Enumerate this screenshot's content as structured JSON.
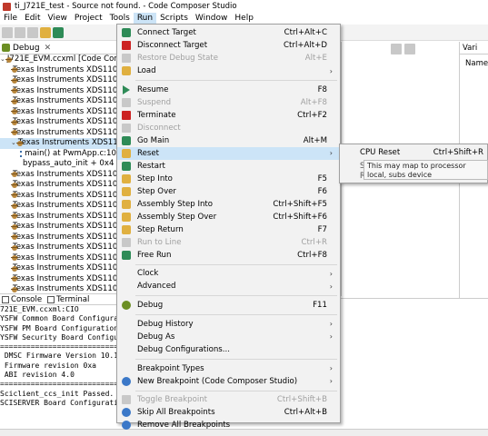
{
  "window": {
    "title": "ti_J721E_test - Source not found. - Code Composer Studio"
  },
  "menubar": [
    "File",
    "Edit",
    "View",
    "Project",
    "Tools",
    "Run",
    "Scripts",
    "Window",
    "Help"
  ],
  "debug_view": {
    "tab_label": "Debug",
    "tab_close": "✕",
    "rows": [
      {
        "text": "J721E_EVM.ccxml [Code Com",
        "twisty": "⌄",
        "kind": "root"
      },
      {
        "text": "Texas Instruments XDS110",
        "kind": "core"
      },
      {
        "text": "Texas Instruments XDS110",
        "kind": "core"
      },
      {
        "text": "Texas Instruments XDS110",
        "kind": "core"
      },
      {
        "text": "Texas Instruments XDS110",
        "kind": "core"
      },
      {
        "text": "Texas Instruments XDS110",
        "kind": "core"
      },
      {
        "text": "Texas Instruments XDS110",
        "kind": "core"
      },
      {
        "text": "Texas Instruments XDS110",
        "kind": "core"
      },
      {
        "text": "Texas Instruments XDS110",
        "twisty": "⌄",
        "kind": "core",
        "selected": true
      },
      {
        "text": "main() at PwmApp.c:10",
        "kind": "frame"
      },
      {
        "text": "bypass_auto_init + 0x4 (",
        "kind": "frame"
      },
      {
        "text": "Texas Instruments XDS110",
        "kind": "core"
      },
      {
        "text": "Texas Instruments XDS110",
        "kind": "core"
      },
      {
        "text": "Texas Instruments XDS110",
        "kind": "core"
      },
      {
        "text": "Texas Instruments XDS110",
        "kind": "core"
      },
      {
        "text": "Texas Instruments XDS110",
        "kind": "core"
      },
      {
        "text": "Texas Instruments XDS110",
        "kind": "core"
      },
      {
        "text": "Texas Instruments XDS110",
        "kind": "core"
      },
      {
        "text": "Texas Instruments XDS110",
        "kind": "core"
      },
      {
        "text": "Texas Instruments XDS110",
        "kind": "core"
      },
      {
        "text": "Texas Instruments XDS110",
        "kind": "core"
      },
      {
        "text": "Texas Instruments XDS110",
        "kind": "core"
      },
      {
        "text": "Texas Instruments XDS110",
        "kind": "core"
      }
    ]
  },
  "console": {
    "tab_console": "Console",
    "tab_terminal": "Terminal",
    "lines": [
      "721E_EVM.ccxml:CIO",
      "YSFW Common Board Configurat",
      "YSFW PM Board Configuration.",
      "YSFW Security Board Configur",
      "================================",
      " DMSC Firmware Version 10.1.6",
      " Firmware revision 0xa",
      " ABI revision 4.0",
      "================================",
      "Sciclient_ccs_init Passed.",
      "SCISERVER Board Configuration"
    ]
  },
  "right_pane": {
    "vars_tab": "Vari",
    "col_name": "Name"
  },
  "run_menu": {
    "items": [
      {
        "label": "Connect Target",
        "shortcut": "Ctrl+Alt+C",
        "icon": "connect-icon",
        "enabled": true
      },
      {
        "label": "Disconnect Target",
        "shortcut": "Ctrl+Alt+D",
        "icon": "disconnect-icon",
        "enabled": true
      },
      {
        "label": "Restore Debug State",
        "shortcut": "Alt+E",
        "icon": "restore-icon",
        "enabled": false
      },
      {
        "label": "Load",
        "shortcut": "",
        "icon": "load-icon",
        "enabled": true,
        "submenu": true
      },
      {
        "sep": true
      },
      {
        "label": "Resume",
        "shortcut": "F8",
        "icon": "resume-icon",
        "enabled": true
      },
      {
        "label": "Suspend",
        "shortcut": "Alt+F8",
        "icon": "suspend-icon",
        "enabled": false
      },
      {
        "label": "Terminate",
        "shortcut": "Ctrl+F2",
        "icon": "terminate-icon",
        "enabled": true
      },
      {
        "label": "Disconnect",
        "shortcut": "",
        "icon": "disconnect-small-icon",
        "enabled": false
      },
      {
        "label": "Go Main",
        "shortcut": "Alt+M",
        "icon": "go-main-icon",
        "enabled": true
      },
      {
        "label": "Reset",
        "shortcut": "",
        "icon": "reset-icon",
        "enabled": true,
        "submenu": true,
        "highlighted": true
      },
      {
        "label": "Restart",
        "shortcut": "",
        "icon": "restart-icon",
        "enabled": true
      },
      {
        "label": "Step Into",
        "shortcut": "F5",
        "icon": "step-into-icon",
        "enabled": true
      },
      {
        "label": "Step Over",
        "shortcut": "F6",
        "icon": "step-over-icon",
        "enabled": true
      },
      {
        "label": "Assembly Step Into",
        "shortcut": "Ctrl+Shift+F5",
        "icon": "asm-step-into-icon",
        "enabled": true
      },
      {
        "label": "Assembly Step Over",
        "shortcut": "Ctrl+Shift+F6",
        "icon": "asm-step-over-icon",
        "enabled": true
      },
      {
        "label": "Step Return",
        "shortcut": "F7",
        "icon": "step-return-icon",
        "enabled": true
      },
      {
        "label": "Run to Line",
        "shortcut": "Ctrl+R",
        "icon": "run-to-line-icon",
        "enabled": false
      },
      {
        "label": "Free Run",
        "shortcut": "Ctrl+F8",
        "icon": "free-run-icon",
        "enabled": true
      },
      {
        "sep": true
      },
      {
        "label": "Clock",
        "shortcut": "",
        "icon": "",
        "enabled": true,
        "submenu": true
      },
      {
        "label": "Advanced",
        "shortcut": "",
        "icon": "",
        "enabled": true,
        "submenu": true
      },
      {
        "sep": true
      },
      {
        "label": "Debug",
        "shortcut": "F11",
        "icon": "debug-icon",
        "enabled": true
      },
      {
        "sep": true
      },
      {
        "label": "Debug History",
        "shortcut": "",
        "icon": "",
        "enabled": true,
        "submenu": true
      },
      {
        "label": "Debug As",
        "shortcut": "",
        "icon": "",
        "enabled": true,
        "submenu": true
      },
      {
        "label": "Debug Configurations...",
        "shortcut": "",
        "icon": "",
        "enabled": true
      },
      {
        "sep": true
      },
      {
        "label": "Breakpoint Types",
        "shortcut": "",
        "icon": "",
        "enabled": true,
        "submenu": true
      },
      {
        "label": "New Breakpoint (Code Composer Studio)",
        "shortcut": "",
        "icon": "breakpoint-icon",
        "enabled": true,
        "submenu": true
      },
      {
        "sep": true
      },
      {
        "label": "Toggle Breakpoint",
        "shortcut": "Ctrl+Shift+B",
        "icon": "toggle-bp-icon",
        "enabled": false
      },
      {
        "label": "Skip All Breakpoints",
        "shortcut": "Ctrl+Alt+B",
        "icon": "skip-bp-icon",
        "enabled": true
      },
      {
        "label": "Remove All Breakpoints",
        "shortcut": "",
        "icon": "remove-bp-icon",
        "enabled": true
      }
    ]
  },
  "reset_submenu": {
    "item_label": "CPU Reset",
    "item_shortcut": "Ctrl+Shift+R",
    "frag1": "S",
    "frag2": "R",
    "tooltip": "This may map to processor local, subs device"
  },
  "colors": {
    "highlight": "#cce4f7",
    "menu_bg": "#f2f2f2",
    "disabled": "#a0a0a0"
  }
}
